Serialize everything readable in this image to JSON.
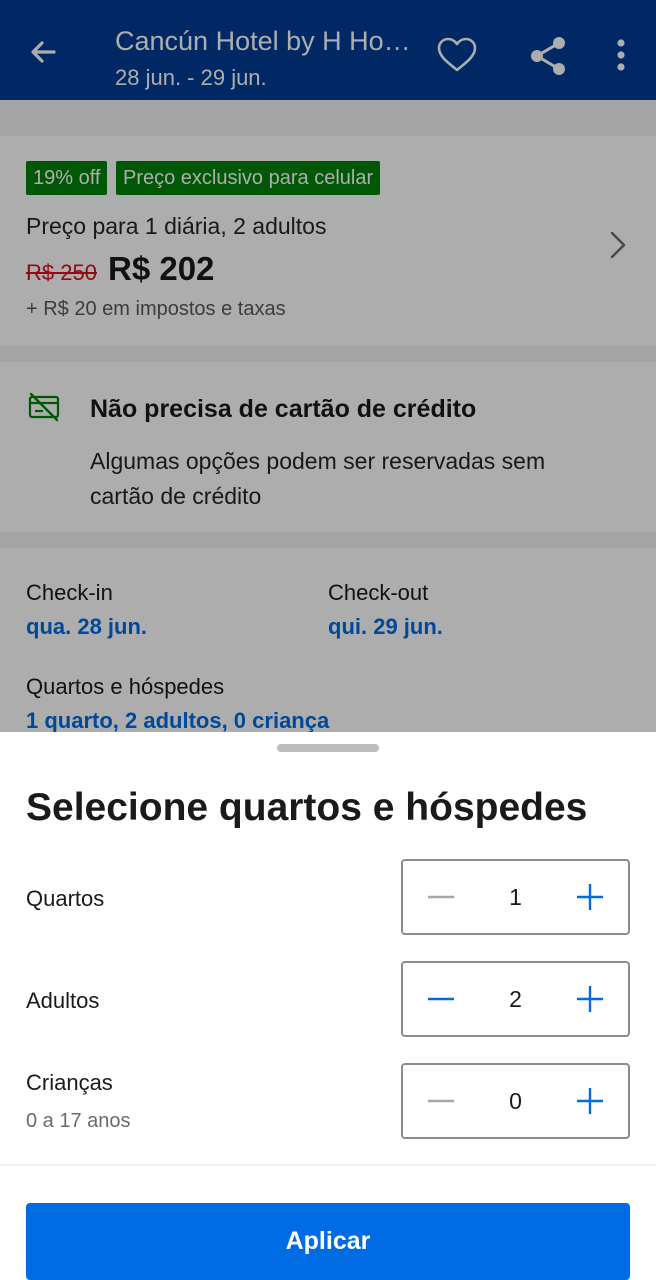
{
  "header": {
    "title": "Cancún Hotel by H Hotels",
    "dates": "28 jun. - 29 jun.",
    "icons": [
      "back-arrow-icon",
      "heart-icon",
      "share-icon",
      "more-vert-icon"
    ]
  },
  "price_card": {
    "badge_discount": "19% off",
    "badge_mobile": "Preço exclusivo para celular",
    "per_night": "Preço para 1 diária, 2 adultos",
    "old_price": "R$ 250",
    "new_price": "R$ 202",
    "taxes": "+ R$ 20 em impostos e taxas"
  },
  "no_card": {
    "title": "Não precisa de cartão de crédito",
    "text": "Algumas opções podem ser reservadas sem cartão de crédito"
  },
  "stay": {
    "checkin_label": "Check-in",
    "checkin_value": "qua. 28 jun.",
    "checkout_label": "Check-out",
    "checkout_value": "qui. 29 jun.",
    "rooms_label": "Quartos e hóspedes",
    "rooms_value": "1 quarto, 2 adultos, 0 criança"
  },
  "sheet": {
    "title": "Selecione quartos e hóspedes",
    "rows": [
      {
        "label": "Quartos",
        "sub": "",
        "value": "1",
        "minus_enabled": false
      },
      {
        "label": "Adultos",
        "sub": "",
        "value": "2",
        "minus_enabled": true
      },
      {
        "label": "Crianças",
        "sub": "0 a 17 anos",
        "value": "0",
        "minus_enabled": false
      }
    ],
    "apply_label": "Aplicar"
  },
  "colors": {
    "header_bg": "#003c95",
    "primary": "#006ce4",
    "badge_green": "#008009",
    "old_price_red": "#d4111e",
    "disabled": "#a6a6a6"
  }
}
